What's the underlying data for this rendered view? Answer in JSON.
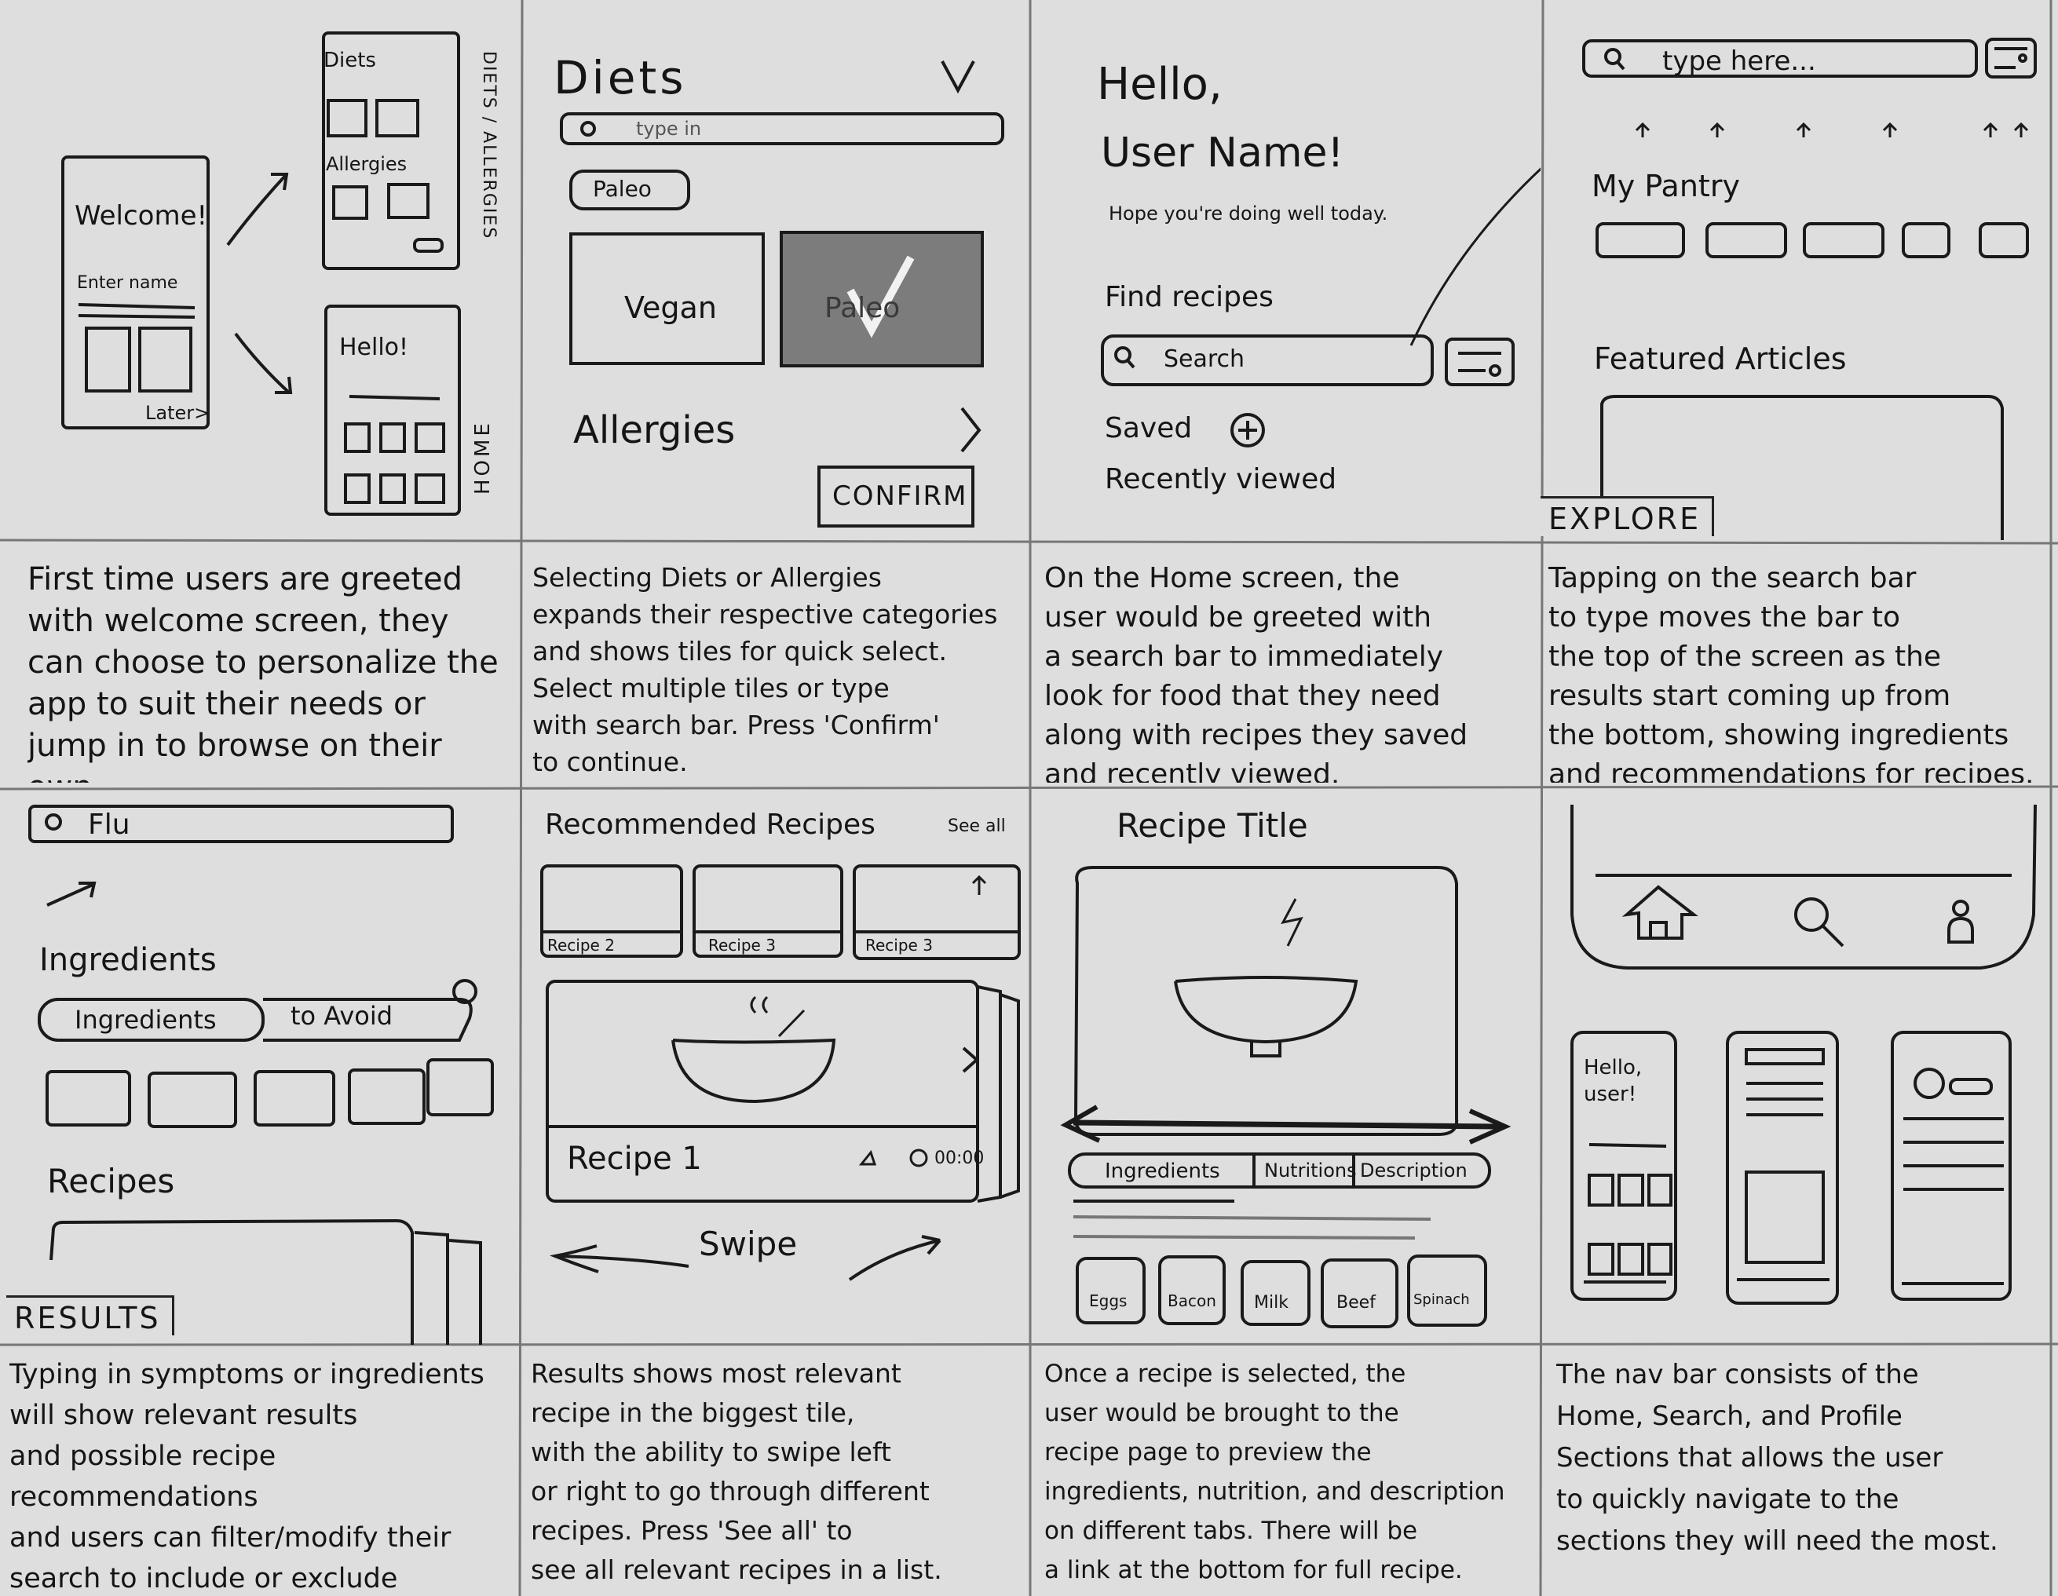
{
  "panels": {
    "p1": {
      "welcome": "Welcome!",
      "enter_name": "Enter name",
      "later": "Later>",
      "diets": "Diets",
      "allergies": "Allergies",
      "side_label_1": "DIETS / ALLERGIES",
      "hello": "Hello!",
      "side_label_2": "HOME",
      "caption": "First time users are greeted\nwith welcome screen, they\ncan choose to personalize the\napp to suit their needs or\njump in to browse on their own."
    },
    "p2": {
      "title": "Diets",
      "search_placeholder": "type in",
      "chip": "Paleo",
      "tile_left": "Vegan",
      "tile_right": "Paleo",
      "allergies": "Allergies",
      "confirm": "CONFIRM",
      "caption": "Selecting Diets or Allergies\nexpands their respective categories\nand shows tiles for quick select.\nSelect multiple tiles or type\nwith search bar. Press 'Confirm'\nto continue."
    },
    "p3": {
      "hello": "Hello,",
      "user_name": "User Name!",
      "subtitle": "Hope you're doing well today.",
      "find": "Find recipes",
      "search": "Search",
      "saved": "Saved",
      "recent": "Recently viewed",
      "caption": "On the Home screen, the\nuser would be greeted with\na search bar to immediately\nlook for food that they need\nalong with recipes they saved\nand recently viewed."
    },
    "p4": {
      "search": "type here...",
      "pantry": "My Pantry",
      "featured": "Featured Articles",
      "tag": "EXPLORE",
      "caption": "Tapping on the search bar\nto type moves the bar to\nthe top of the screen as the\nresults start coming up from\nthe bottom, showing ingredients\nand recommendations for recipes."
    },
    "p5": {
      "search": "Flu",
      "ingredients": "Ingredients",
      "tab1": "Ingredients",
      "tab2": "to Avoid",
      "recipes": "Recipes",
      "tag": "RESULTS",
      "caption": "Typing in symptoms or ingredients\nwill show relevant results\nand possible recipe recommendations\nand users can filter/modify their\nsearch to include or exclude\ncertain ingredients or sort items"
    },
    "p6": {
      "title": "Recommended Recipes",
      "see_all": "See all",
      "r2": "Recipe 2",
      "r3a": "Recipe 3",
      "r3b": "Recipe 3",
      "main": "Recipe 1",
      "time": "00:00",
      "swipe": "Swipe",
      "caption": "Results shows most relevant\nrecipe in the biggest tile,\nwith the ability to swipe left\nor right to go through different\nrecipes. Press 'See all' to\nsee all relevant recipes in a list."
    },
    "p7": {
      "title": "Recipe Title",
      "tab1": "Ingredients",
      "tab2": "Nutritions",
      "tab3": "Description",
      "ing1": "Eggs",
      "ing2": "Bacon",
      "ing3": "Milk",
      "ing4": "Beef",
      "ing5": "Spinach",
      "caption": "Once a recipe is selected, the\nuser would be brought to the\nrecipe page to preview the\ningredients, nutrition, and description\non different tabs. There will be\na link at the bottom for full recipe."
    },
    "p8": {
      "hello_user": "Hello,\nuser!",
      "caption": "The nav bar consists of the\nHome, Search, and Profile\nSections that allows the user\nto quickly navigate to the\nsections they will need the most."
    }
  }
}
